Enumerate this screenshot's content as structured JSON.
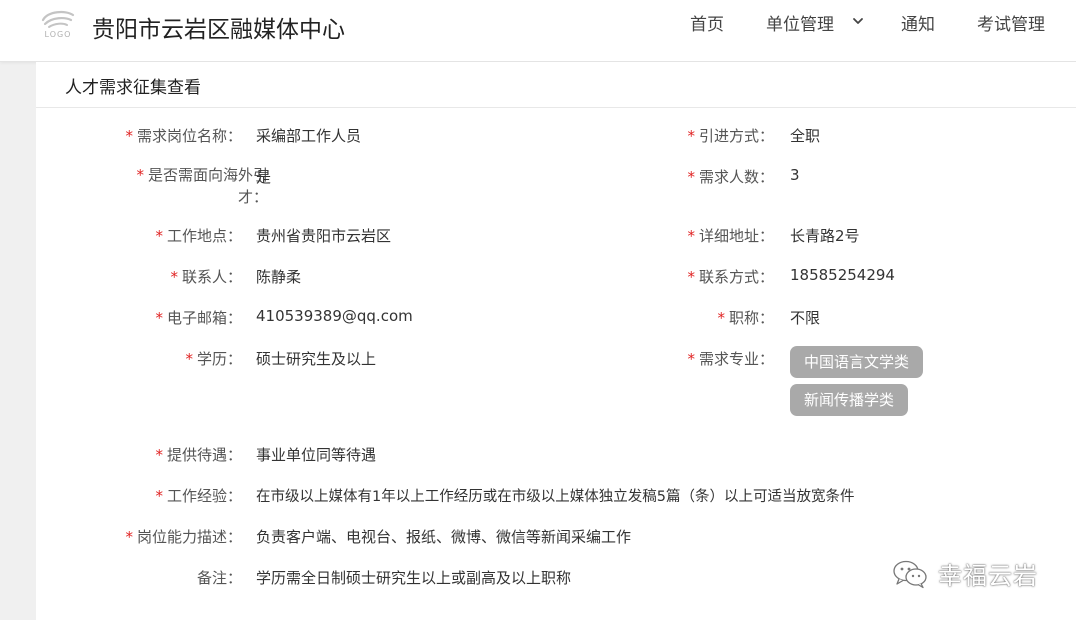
{
  "header": {
    "logo_text": "LOGO",
    "site_title": "贵阳市云岩区融媒体中心",
    "nav": {
      "home": "首页",
      "unit_management": "单位管理",
      "notice": "通知",
      "exam_management": "考试管理"
    }
  },
  "panel": {
    "title": "人才需求征集查看"
  },
  "form": {
    "position_name": {
      "label": "需求岗位名称：",
      "value": "采编部工作人员"
    },
    "intro_method": {
      "label": "引进方式：",
      "value": "全职"
    },
    "overseas": {
      "label_line1": "是否需面向海外引",
      "label_line2": "才：",
      "value": "是"
    },
    "headcount": {
      "label": "需求人数：",
      "value": "3"
    },
    "work_location": {
      "label": "工作地点：",
      "value": "贵州省贵阳市云岩区"
    },
    "address": {
      "label": "详细地址：",
      "value": "长青路2号"
    },
    "contact": {
      "label": "联系人：",
      "value": "陈静柔"
    },
    "phone": {
      "label": "联系方式：",
      "value": "18585254294"
    },
    "email": {
      "label": "电子邮箱：",
      "value": "410539389@qq.com"
    },
    "title_rank": {
      "label": "职称：",
      "value": "不限"
    },
    "education": {
      "label": "学历：",
      "value": "硕士研究生及以上"
    },
    "major": {
      "label": "需求专业：",
      "tags": [
        "中国语言文学类",
        "新闻传播学类"
      ]
    },
    "benefits": {
      "label": "提供待遇：",
      "value": "事业单位同等待遇"
    },
    "experience": {
      "label": "工作经验：",
      "value": "在市级以上媒体有1年以上工作经历或在市级以上媒体独立发稿5篇（条）以上可适当放宽条件"
    },
    "duties": {
      "label": "岗位能力描述：",
      "value": "负责客户端、电视台、报纸、微博、微信等新闻采编工作"
    },
    "remarks": {
      "label": "备注：",
      "value": "学历需全日制硕士研究生以上或副高及以上职称"
    }
  },
  "watermark": {
    "text": "幸福云岩"
  },
  "colors": {
    "required_star": "#e02424",
    "tag_bg": "#a9a9a9",
    "page_bg": "#f0f0f0"
  }
}
